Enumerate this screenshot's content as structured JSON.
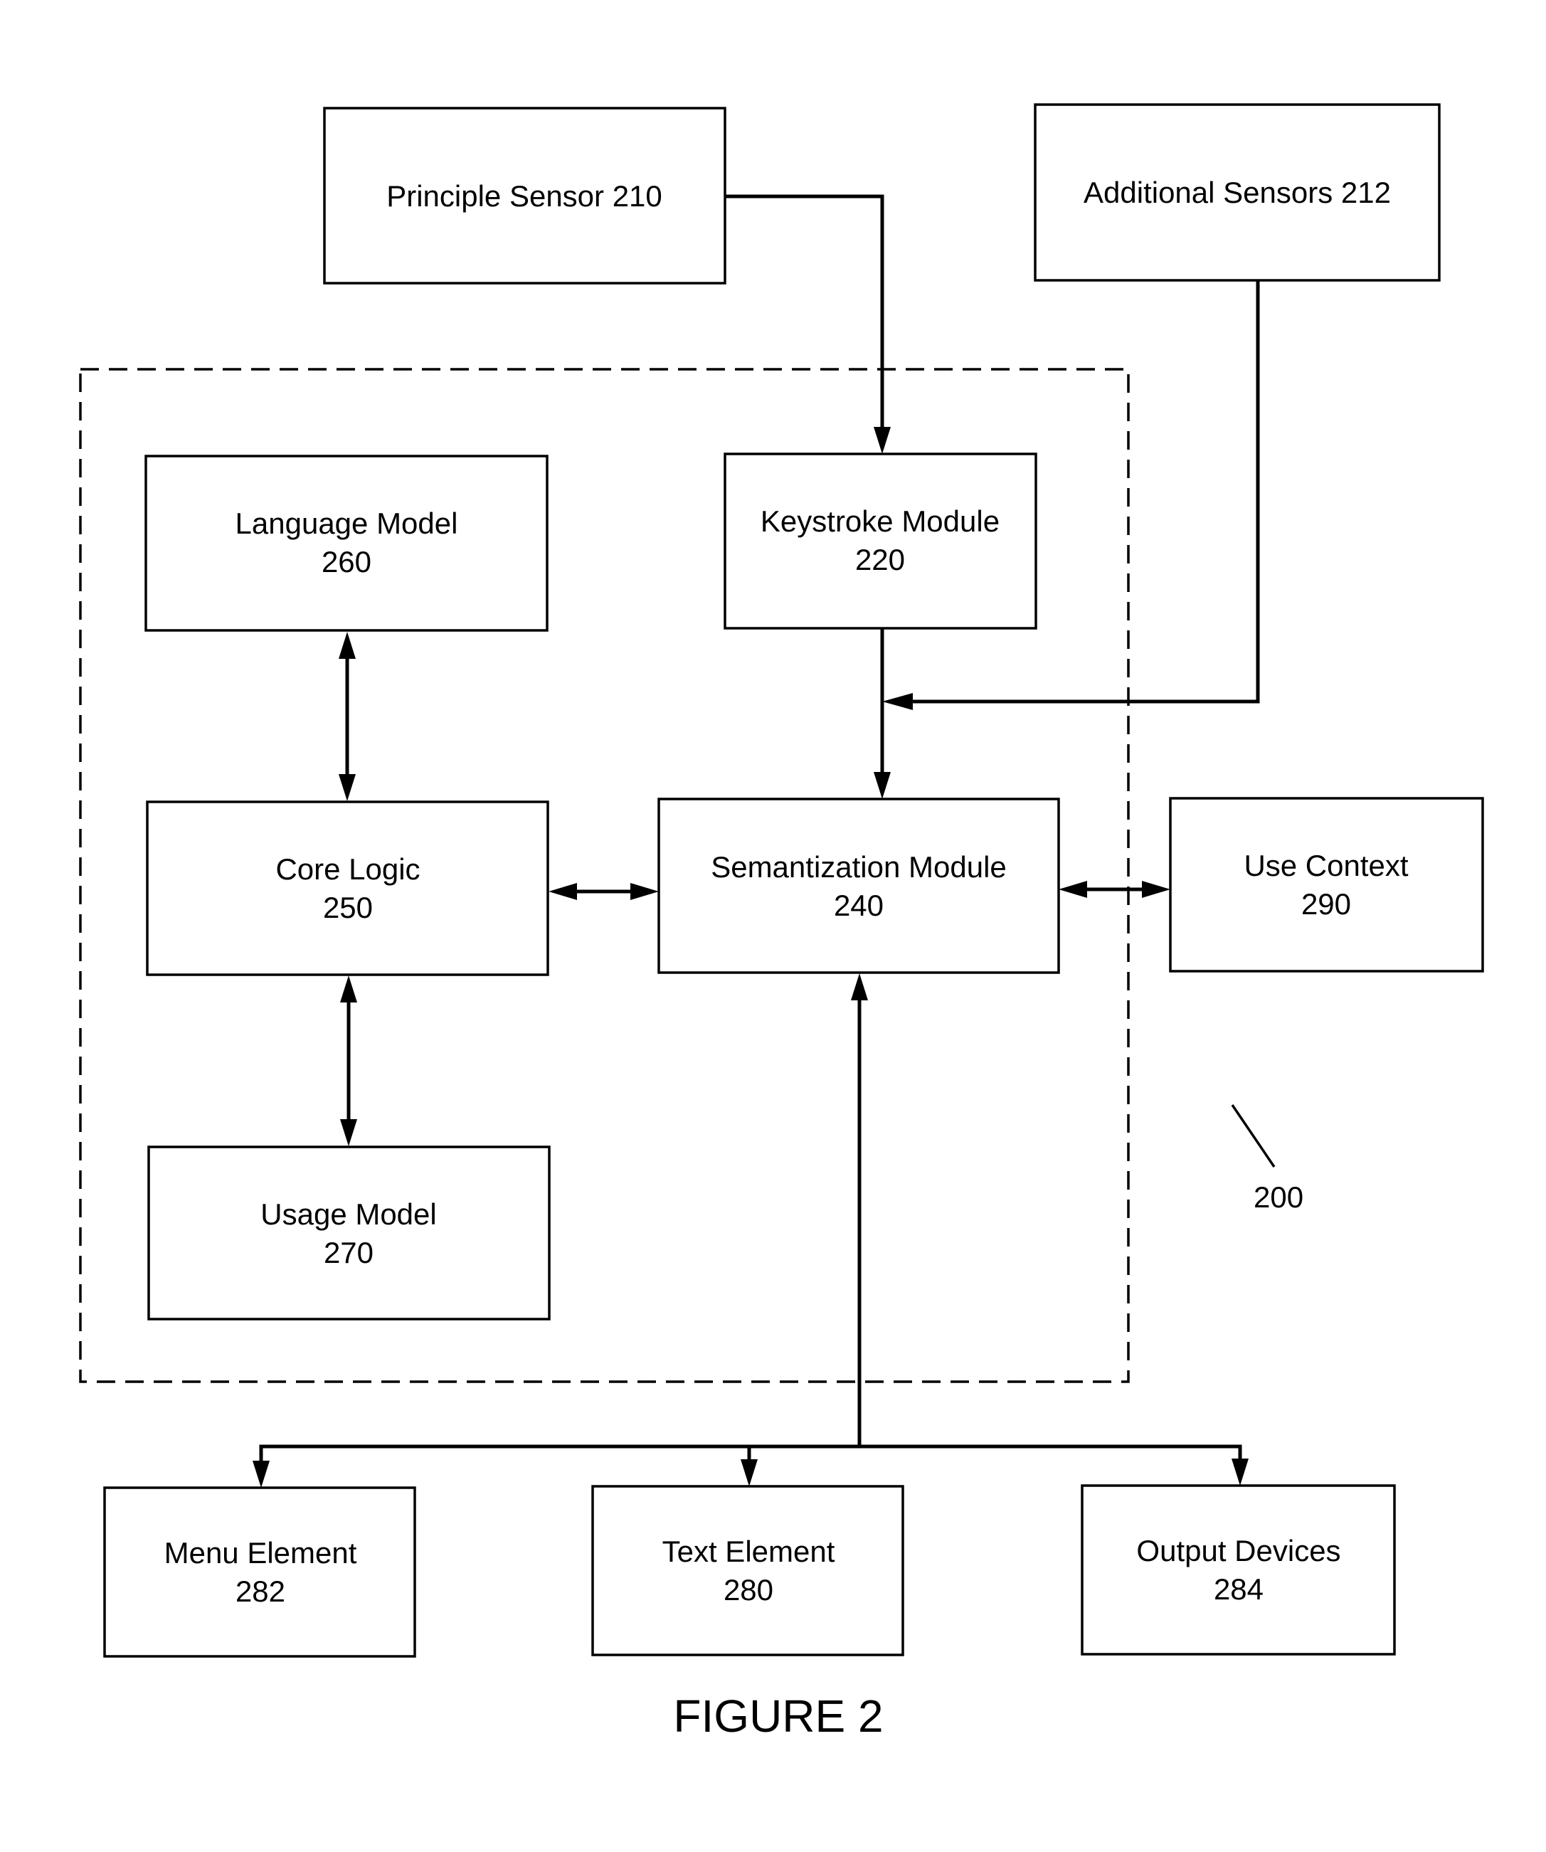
{
  "figure": {
    "caption": "FIGURE 2",
    "reference_numeral": "200"
  },
  "blocks": {
    "principle_sensor": {
      "lines": [
        "Principle Sensor 210"
      ]
    },
    "additional_sensors": {
      "lines": [
        "Additional Sensors 212"
      ]
    },
    "language_model": {
      "lines": [
        "Language Model",
        "260"
      ]
    },
    "keystroke_module": {
      "lines": [
        "Keystroke Module",
        "220"
      ]
    },
    "core_logic": {
      "lines": [
        "Core Logic",
        "250"
      ]
    },
    "semantization_module": {
      "lines": [
        "Semantization Module",
        "240"
      ]
    },
    "use_context": {
      "lines": [
        "Use Context",
        "290"
      ]
    },
    "usage_model": {
      "lines": [
        "Usage Model",
        "270"
      ]
    },
    "menu_element": {
      "lines": [
        "Menu Element",
        "282"
      ]
    },
    "text_element": {
      "lines": [
        "Text Element",
        "280"
      ]
    },
    "output_devices": {
      "lines": [
        "Output Devices",
        "284"
      ]
    }
  },
  "connections": [
    {
      "from": "principle_sensor",
      "to": "keystroke_module",
      "type": "directed"
    },
    {
      "from": "additional_sensors",
      "to": "keystroke_to_semantization_line",
      "type": "directed"
    },
    {
      "from": "keystroke_module",
      "to": "semantization_module",
      "type": "directed"
    },
    {
      "from": "language_model",
      "to": "core_logic",
      "type": "bidirectional"
    },
    {
      "from": "core_logic",
      "to": "usage_model",
      "type": "bidirectional"
    },
    {
      "from": "core_logic",
      "to": "semantization_module",
      "type": "bidirectional"
    },
    {
      "from": "semantization_module",
      "to": "use_context",
      "type": "bidirectional"
    },
    {
      "from": "bus",
      "to": "semantization_module",
      "type": "directed"
    },
    {
      "from": "bus",
      "to": "menu_element",
      "type": "directed"
    },
    {
      "from": "bus",
      "to": "text_element",
      "type": "directed"
    },
    {
      "from": "bus",
      "to": "output_devices",
      "type": "directed"
    }
  ]
}
